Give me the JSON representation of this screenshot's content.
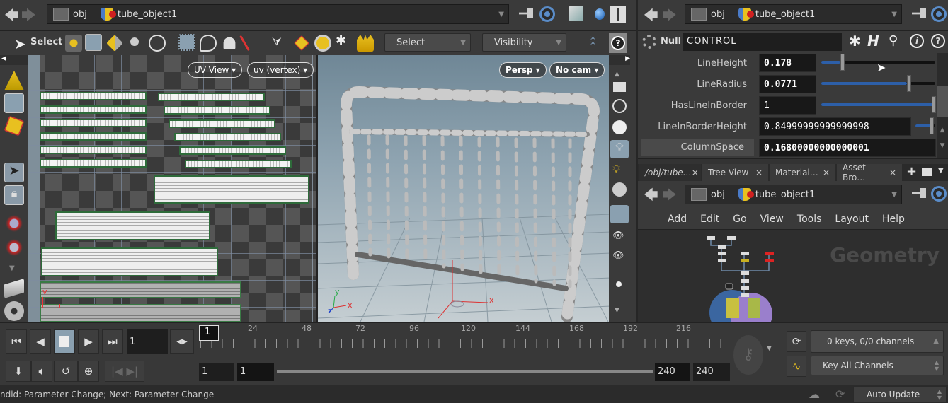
{
  "left_pane": {
    "path": {
      "root": "obj",
      "node": "tube_object1"
    },
    "toolbar": {
      "select_label": "Select",
      "select_mode_combo": "Select",
      "visibility_combo": "Visibility",
      "help_icon": "?"
    },
    "uv_view": {
      "view_menu": "UV View",
      "attribute_menu": "uv (vertex)",
      "axis_v": "v",
      "axis_u": "u"
    },
    "viewport": {
      "camera_menu": "Persp",
      "cam_menu": "No cam",
      "axis_x": "x",
      "axis_y": "y",
      "axis_z": "z"
    }
  },
  "right_pane": {
    "path": {
      "root": "obj",
      "node": "tube_object1"
    },
    "params": {
      "node_type": "Null",
      "node_name": "CONTROL",
      "rows": [
        {
          "label": "LineHeight",
          "value": "0.178",
          "slider_fraction": 0.17
        },
        {
          "label": "LineRadius",
          "value": "0.0771",
          "slider_fraction": 0.75
        },
        {
          "label": "HasLineInBorder",
          "value": "1",
          "slider_fraction": 1.0
        },
        {
          "label": "LineInBorderHeight",
          "value": "0.84999999999999998",
          "slider_fraction": 0.85
        },
        {
          "label": "ColumnSpace",
          "value": "0.16800000000000001"
        }
      ]
    },
    "tabs": [
      {
        "label": "/obj/tube…"
      },
      {
        "label": "Tree View"
      },
      {
        "label": "Material…"
      },
      {
        "label": "Asset Bro…"
      }
    ],
    "network": {
      "path": {
        "root": "obj",
        "node": "tube_object1"
      },
      "menu": [
        "Add",
        "Edit",
        "Go",
        "View",
        "Tools",
        "Layout",
        "Help"
      ],
      "context_label": "Geometry"
    }
  },
  "timeline": {
    "current_frame": "1",
    "frame_marker": "1",
    "ticks": [
      "24",
      "48",
      "72",
      "96",
      "120",
      "144",
      "168",
      "192",
      "216"
    ],
    "range_start": "1",
    "range_start_2": "1",
    "range_end": "240",
    "range_end_2": "240",
    "keys_status": "0 keys, 0/0 channels",
    "key_mode": "Key All Channels"
  },
  "status_bar": {
    "message": "ndid: Parameter Change; Next: Parameter Change",
    "update_mode": "Auto Update"
  },
  "colors": {
    "accent": "#2d5fa8",
    "uv_border": "#2e6b3a"
  }
}
